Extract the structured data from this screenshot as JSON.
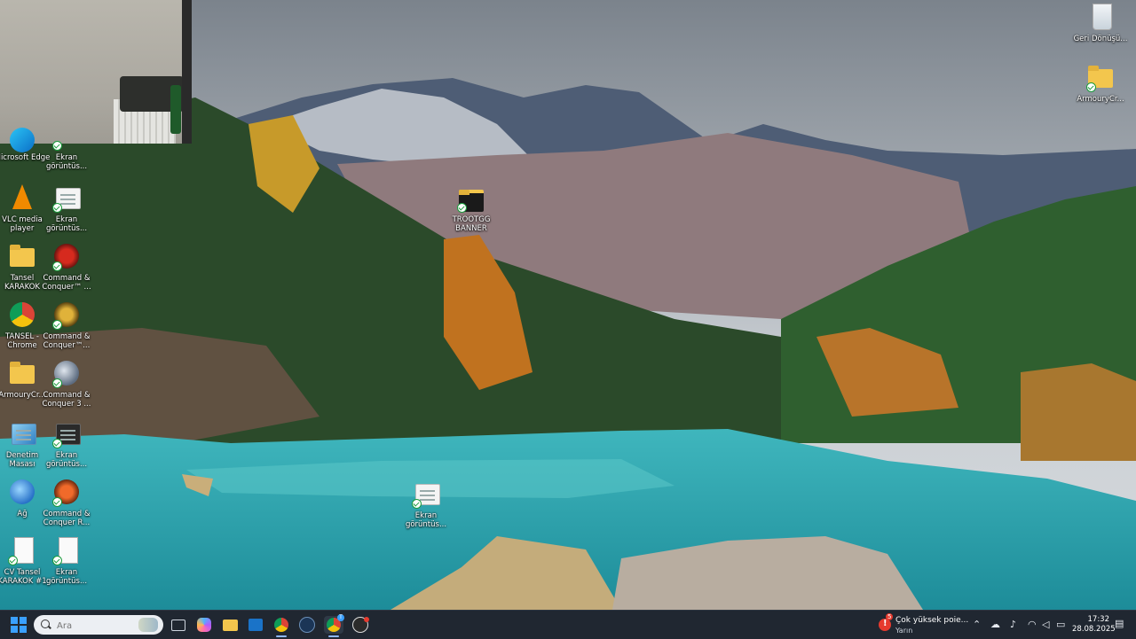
{
  "desktop": {
    "icons": [
      {
        "id": "edge",
        "label": "Microsoft Edge"
      },
      {
        "id": "screenshot1",
        "label": "Ekran görüntüs..."
      },
      {
        "id": "vlc",
        "label": "VLC media player"
      },
      {
        "id": "screenshot2",
        "label": "Ekran görüntüs..."
      },
      {
        "id": "user-folder",
        "label": "Tansel KARAKOK"
      },
      {
        "id": "cnc3",
        "label": "Command & Conquer™ ..."
      },
      {
        "id": "chrome",
        "label": "TANSEL - Chrome"
      },
      {
        "id": "cnc-gen",
        "label": "Command & Conquer™..."
      },
      {
        "id": "armoury",
        "label": "ArmouryCr..."
      },
      {
        "id": "cnc3b",
        "label": "Command & Conquer 3 ..."
      },
      {
        "id": "control-panel",
        "label": "Denetim Masası"
      },
      {
        "id": "screenshot3",
        "label": "Ekran görüntüs..."
      },
      {
        "id": "network",
        "label": "Ağ"
      },
      {
        "id": "cnc-ra",
        "label": "Command & Conquer R..."
      },
      {
        "id": "cv",
        "label": "CV Tansel KARAKOK #1"
      },
      {
        "id": "screenshot4",
        "label": "Ekran görüntüs..."
      },
      {
        "id": "trootgg",
        "label": "TROOTGG BANNER"
      },
      {
        "id": "screenshot5",
        "label": "Ekran görüntüs..."
      },
      {
        "id": "recycle",
        "label": "Geri Dönüşü..."
      },
      {
        "id": "armoury-folder",
        "label": "ArmouryCr..."
      }
    ]
  },
  "taskbar": {
    "search_placeholder": "Ara",
    "apps": [
      "task-view",
      "copilot",
      "file-explorer",
      "outlook",
      "chrome",
      "steam",
      "chrome-profile",
      "obs"
    ],
    "chrome_profile_badge": "T",
    "notification": {
      "title": "Çok yüksek poie...",
      "subtitle": "Yarın",
      "count": "5"
    },
    "tray_icons": [
      "chevron-up",
      "network-device",
      "microphone",
      "wifi",
      "speaker",
      "battery"
    ],
    "clock": {
      "time": "17:32",
      "date": "28.08.2025"
    }
  },
  "colors": {
    "accent": "#3aa0ff",
    "taskbar": "#202731",
    "notification_red": "#e63a2e"
  }
}
